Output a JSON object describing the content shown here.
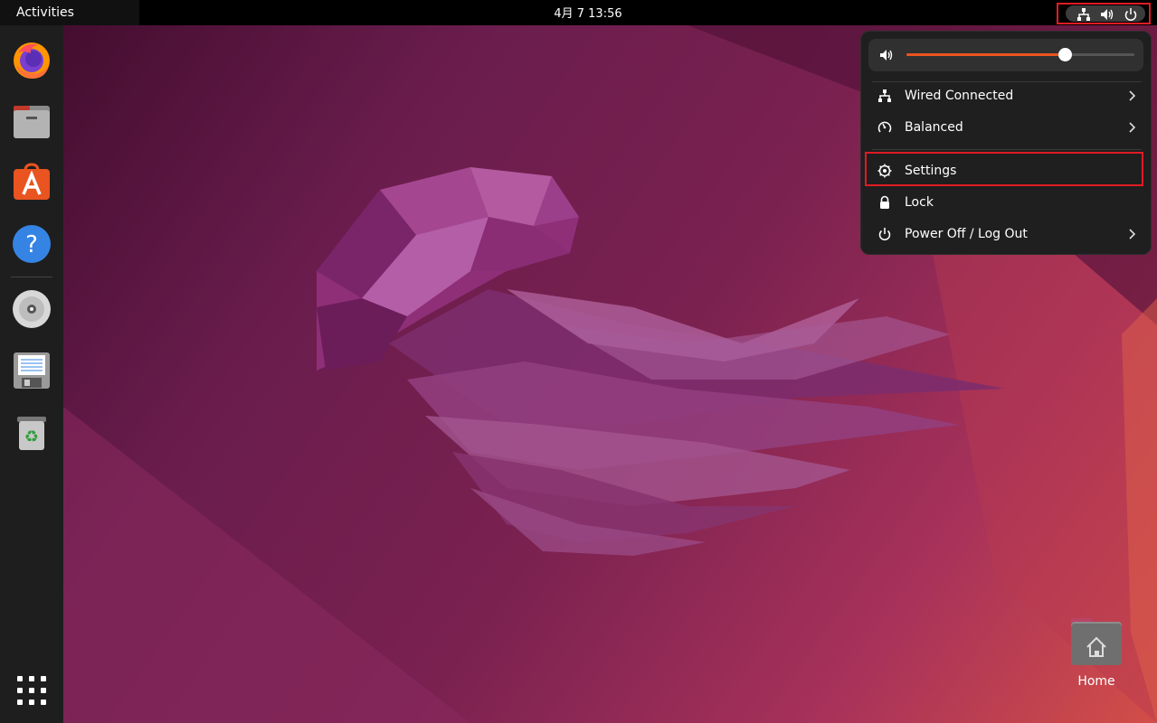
{
  "topbar": {
    "activities_label": "Activities",
    "clock": "4月 7  13:56",
    "status_icons": [
      "network-wired-icon",
      "volume-icon",
      "power-icon"
    ]
  },
  "dock": {
    "items": [
      {
        "name": "Firefox",
        "icon": "firefox-icon"
      },
      {
        "name": "Files",
        "icon": "files-icon"
      },
      {
        "name": "Ubuntu Software",
        "icon": "software-store-icon"
      },
      {
        "name": "Help",
        "icon": "help-icon"
      },
      {
        "name": "Optical disc",
        "icon": "disc-icon"
      },
      {
        "name": "Save",
        "icon": "floppy-icon"
      },
      {
        "name": "Trash",
        "icon": "trash-icon"
      }
    ],
    "app_grid_icon": "app-grid-icon"
  },
  "desktop": {
    "home_label": "Home"
  },
  "quick_menu": {
    "volume_level": 0.7,
    "items": [
      {
        "label": "Wired Connected",
        "icon": "network-wired-icon",
        "has_submenu": true
      },
      {
        "label": "Balanced",
        "icon": "power-profile-icon",
        "has_submenu": true
      },
      {
        "label": "Settings",
        "icon": "settings-gear-icon",
        "has_submenu": false
      },
      {
        "label": "Lock",
        "icon": "lock-icon",
        "has_submenu": false
      },
      {
        "label": "Power Off / Log Out",
        "icon": "power-icon",
        "has_submenu": true
      }
    ]
  },
  "colors": {
    "accent": "#e95420",
    "highlight_box": "#e01b24",
    "menu_bg": "#1f1f1f",
    "dock_bg": "#1e1e1e"
  }
}
